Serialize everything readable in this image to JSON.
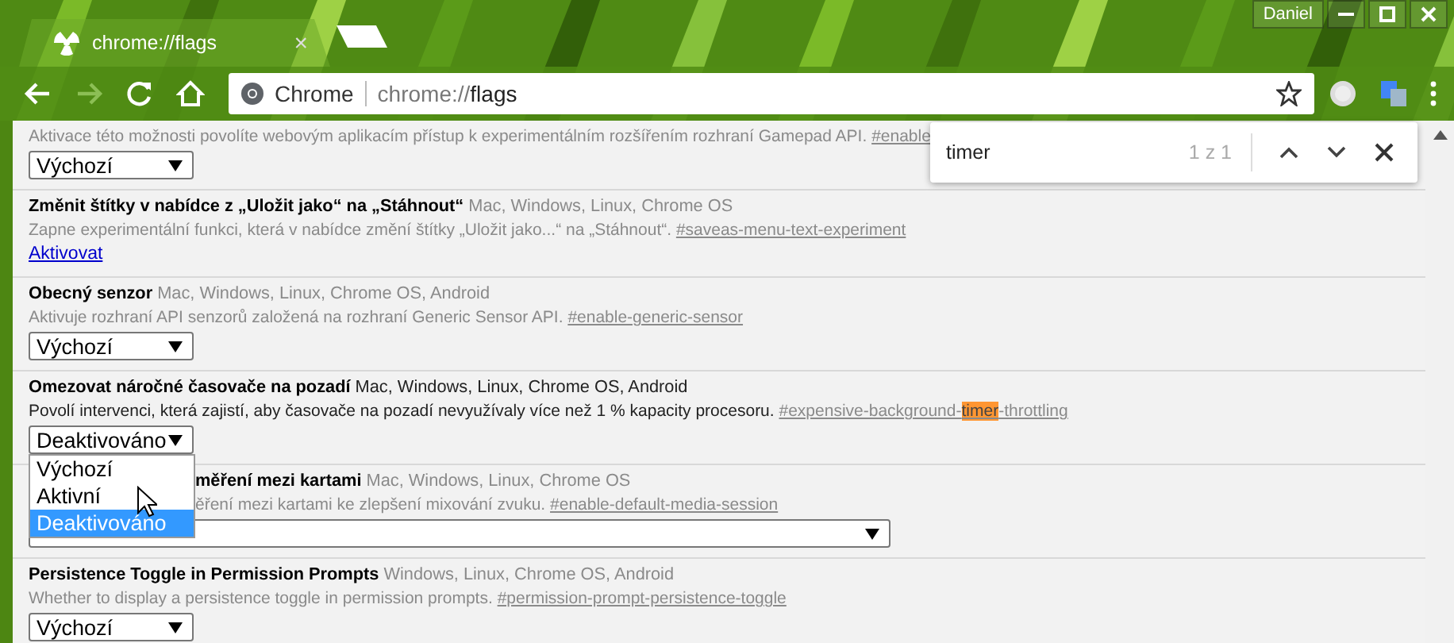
{
  "window": {
    "profile": "Daniel"
  },
  "tab": {
    "title": "chrome://flags",
    "close": "×"
  },
  "address": {
    "site": "Chrome",
    "url_host": "chrome://",
    "url_path": "flags"
  },
  "find": {
    "query": "timer",
    "count": "1 z 1"
  },
  "flags": [
    {
      "modified": false,
      "description": "Aktivace této možnosti povolíte webovým aplikacím přístup k experimentálním rozšířením rozhraní Gamepad API.",
      "anchor": [
        {
          "text": "#enable",
          "highlighted": false
        }
      ],
      "control": {
        "kind": "select",
        "value": "Výchozí"
      }
    },
    {
      "title": "Změnit štítky v nabídce z „Uložit jako“ na „Stáhnout“",
      "platforms": "Mac, Windows, Linux, Chrome OS",
      "modified": false,
      "description": "Zapne experimentální funkci, která v nabídce změní štítky „Uložit jako...“ na „Stáhnout“.",
      "anchor": [
        {
          "text": "#saveas-menu-text-experiment",
          "highlighted": false
        }
      ],
      "control": {
        "kind": "link",
        "value": "Aktivovat"
      }
    },
    {
      "title": "Obecný senzor",
      "platforms": "Mac, Windows, Linux, Chrome OS, Android",
      "modified": false,
      "description": "Aktivuje rozhraní API senzorů založená na rozhraní Generic Sensor API.",
      "anchor": [
        {
          "text": "#enable-generic-sensor",
          "highlighted": false
        }
      ],
      "control": {
        "kind": "select",
        "value": "Výchozí"
      }
    },
    {
      "title": "Omezovat náročné časovače na pozadí",
      "platforms": "Mac, Windows, Linux, Chrome OS, Android",
      "modified": true,
      "description": "Povolí intervenci, která zajistí, aby časovače na pozadí nevyužívaly více než 1 % kapacity procesoru.",
      "anchor": [
        {
          "text": "#expensive-background-",
          "highlighted": false
        },
        {
          "text": "timer",
          "highlighted": true
        },
        {
          "text": "-throttling",
          "highlighted": false
        }
      ],
      "control": {
        "kind": "select",
        "value": "Deaktivováno",
        "open": true,
        "options": [
          {
            "label": "Výchozí",
            "selected": false
          },
          {
            "label": "Aktivní",
            "selected": false
          },
          {
            "label": "Deaktivováno",
            "selected": true
          }
        ]
      }
    },
    {
      "title": "měření mezi kartami",
      "platforms": "Mac, Windows, Linux, Chrome OS",
      "modified": false,
      "description": "ěření mezi kartami ke zlepšení mixování zvuku.",
      "anchor": [
        {
          "text": "#enable-default-media-session",
          "highlighted": false
        }
      ],
      "control": {
        "kind": "wide-select"
      }
    },
    {
      "title": "Persistence Toggle in Permission Prompts",
      "platforms": "Windows, Linux, Chrome OS, Android",
      "modified": false,
      "description": "Whether to display a persistence toggle in permission prompts.",
      "anchor": [
        {
          "text": "#permission-prompt-persistence-toggle",
          "highlighted": false
        }
      ],
      "control": {
        "kind": "select",
        "value": "Výchozí"
      }
    }
  ]
}
